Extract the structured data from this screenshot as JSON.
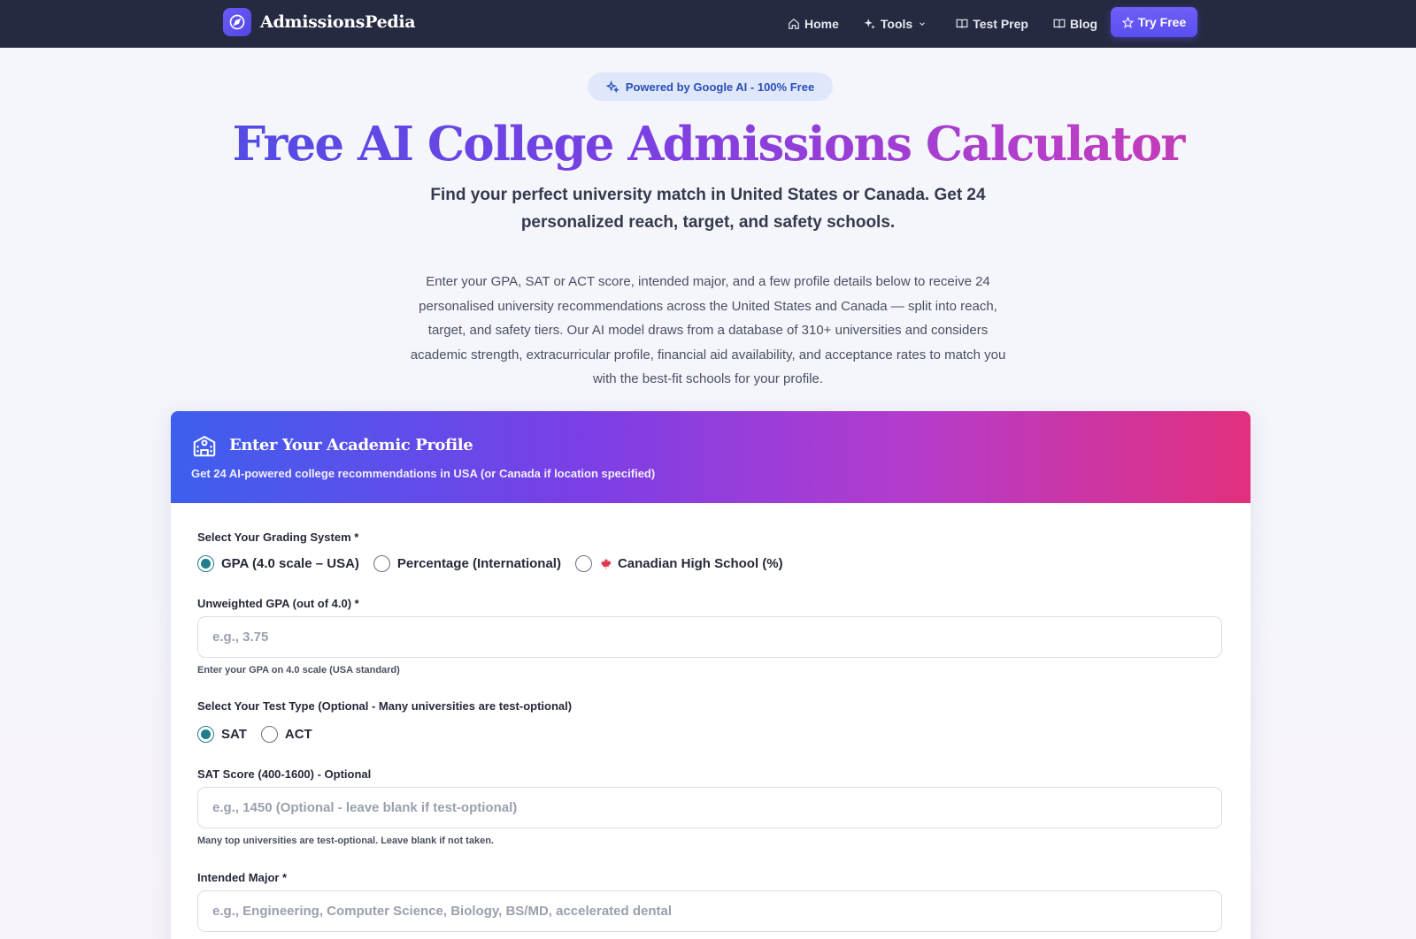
{
  "nav": {
    "brand": "AdmissionsPedia",
    "links": [
      {
        "label": "Home",
        "icon": "home-icon"
      },
      {
        "label": "Tools",
        "icon": "sparkle-icon"
      },
      {
        "label": "Test Prep",
        "icon": "book-icon"
      },
      {
        "label": "Blog",
        "icon": "book-icon"
      }
    ],
    "cta": "Try Free"
  },
  "hero": {
    "badge": "Powered by Google AI - 100% Free",
    "title": "Free AI College Admissions Calculator",
    "subtitle": "Find your perfect university match in United States or Canada. Get 24 personalized reach, target, and safety schools.",
    "description": "Enter your GPA, SAT or ACT score, intended major, and a few profile details below to receive 24 personalised university recommendations across the United States and Canada — split into reach, target, and safety tiers. Our AI model draws from a database of 310+ universities and considers academic strength, extracurricular profile, financial aid availability, and acceptance rates to match you with the best-fit schools for your profile."
  },
  "card": {
    "title": "Enter Your Academic Profile",
    "subtitle": "Get 24 AI-powered college recommendations in USA (or Canada if location specified)"
  },
  "form": {
    "grading_label": "Select Your Grading System *",
    "grading_options": [
      "GPA (4.0 scale – USA)",
      "Percentage (International)",
      "Canadian High School (%)"
    ],
    "gpa_label": "Unweighted GPA (out of 4.0) *",
    "gpa_placeholder": "e.g., 3.75",
    "gpa_hint": "Enter your GPA on 4.0 scale (USA standard)",
    "test_label": "Select Your Test Type (Optional - Many universities are test-optional)",
    "test_options": [
      "SAT",
      "ACT"
    ],
    "sat_label": "SAT Score (400-1600) - Optional",
    "sat_placeholder": "e.g., 1450 (Optional - leave blank if test-optional)",
    "sat_hint": "Many top universities are test-optional. Leave blank if not taken.",
    "major_label": "Intended Major *",
    "major_placeholder": "e.g., Engineering, Computer Science, Biology, BS/MD, accelerated dental"
  },
  "colors": {
    "nav_bg": "#262a41",
    "accent": "#5b4ff0",
    "radio_checked": "#1f7d8c",
    "maple": "#e0344b"
  }
}
